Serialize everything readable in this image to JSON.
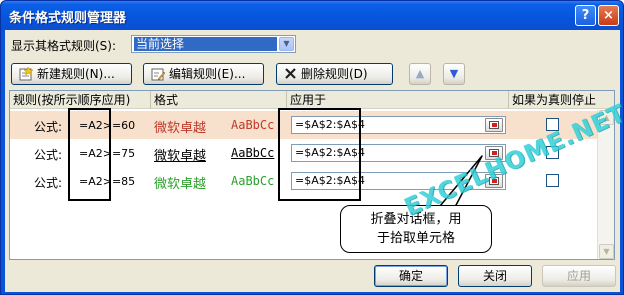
{
  "window": {
    "title": "条件格式规则管理器",
    "help_glyph": "?",
    "close_glyph": "×"
  },
  "scope": {
    "label": "显示其格式规则(S):",
    "selected": "当前选择",
    "arrow": "▼"
  },
  "toolbar": {
    "new_rule": "新建规则(N)...",
    "edit_rule": "编辑规则(E)...",
    "delete_rule": "删除规则(D)",
    "move_up": "▲",
    "move_down": "▼"
  },
  "grid": {
    "headers": [
      "规则(按所示顺序应用)",
      "格式",
      "应用于",
      "如果为真则停止"
    ],
    "rows": [
      {
        "label": "公式:",
        "formula": "=A2>=60",
        "format_text": "微软卓越",
        "format_sample": "AaBbCc",
        "applies_to": "=$A$2:$A$4",
        "stop_if_true": false,
        "selected": true,
        "style": "red"
      },
      {
        "label": "公式:",
        "formula": "=A2>=75",
        "format_text": "微软卓越",
        "format_sample": "AaBbCc",
        "applies_to": "=$A$2:$A$4",
        "stop_if_true": false,
        "selected": false,
        "style": "underline"
      },
      {
        "label": "公式:",
        "formula": "=A2>=85",
        "format_text": "微软卓越",
        "format_sample": "AaBbCc",
        "applies_to": "=$A$2:$A$4",
        "stop_if_true": false,
        "selected": false,
        "style": "green"
      }
    ],
    "scroll_up": "▲",
    "scroll_down": "▼"
  },
  "annotation": {
    "line1": "折叠对话框，用",
    "line2": "于拾取单元格"
  },
  "watermark": "EXCELHOME.NET",
  "buttons": {
    "ok": "确定",
    "close": "关闭",
    "apply": "应用"
  },
  "colors": {
    "title_bar": "#0655dc",
    "selection_row": "#f7e0cc",
    "rule1_format": "#c0392b",
    "rule3_format": "#2ca02c",
    "watermark": "#33d0d8"
  }
}
